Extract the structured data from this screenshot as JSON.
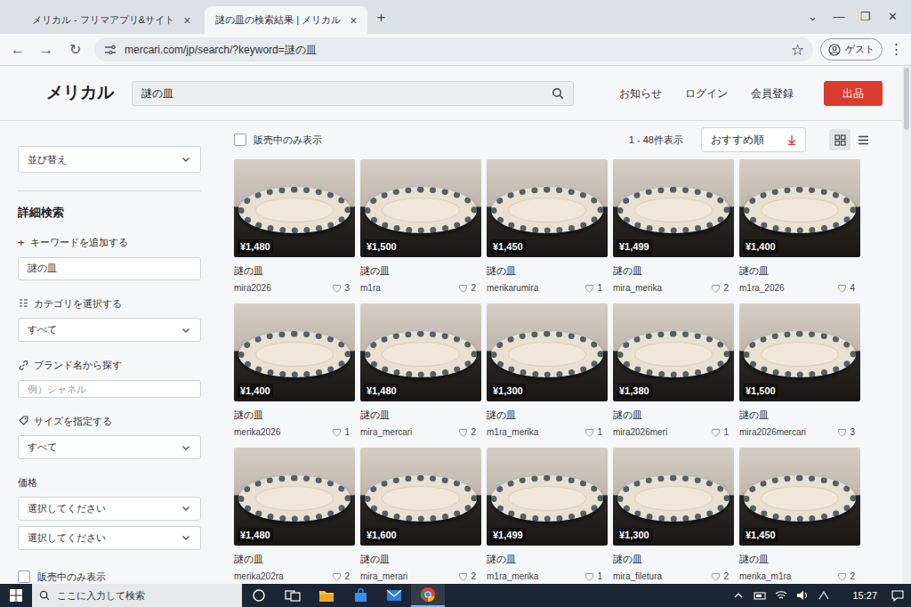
{
  "browser": {
    "tabs": [
      {
        "label": "メリカル - フリマアプリ&サイト",
        "close": "×",
        "selected": false
      },
      {
        "label": "謎の皿の検索結果 | メリカル",
        "close": "×",
        "selected": true
      }
    ],
    "new_tab": "+",
    "window_controls": [
      "⌄",
      "—",
      "❐",
      "✕"
    ],
    "nav": [
      "←",
      "→",
      "↻"
    ],
    "url": "mercari.com/jp/search/?keyword=謎の皿",
    "bookmark": "☆",
    "profile": "ゲスト",
    "menu": "⋮"
  },
  "header": {
    "logo": "メリカル",
    "search_value": "謎の皿",
    "links": [
      "お知らせ",
      "ログイン",
      "会員登録"
    ],
    "sell_button": "出品"
  },
  "sidebar": {
    "sort_label": "並び替え",
    "heading": "詳細検索",
    "keyword": {
      "icon": "+",
      "label": "キーワードを追加する",
      "value": "謎の皿"
    },
    "category": {
      "label": "カテゴリを選択する",
      "value": "すべて"
    },
    "brand": {
      "label": "ブランド名から探す",
      "placeholder": "例）シャネル"
    },
    "size": {
      "label": "サイズを指定する",
      "value": "すべて"
    },
    "price": {
      "label": "価格",
      "min": "選択してください",
      "max": "選択してください"
    },
    "on_sale": {
      "label": "販売中のみ表示",
      "checked": false
    }
  },
  "toolbar": {
    "on_sale": {
      "label": "販売中のみ表示",
      "checked": false
    },
    "count": "1 - 48件表示",
    "sort": "おすすめ順",
    "views": [
      {
        "kind": "grid",
        "selected": true
      },
      {
        "kind": "list",
        "selected": false
      }
    ]
  },
  "grid": {
    "like_icon": "♡",
    "items": [
      {
        "price": "¥1,480",
        "title": "謎の皿",
        "seller": "mira2026",
        "likes": "3"
      },
      {
        "price": "¥1,500",
        "title": "謎の皿",
        "seller": "m1ra",
        "likes": "2"
      },
      {
        "price": "¥1,450",
        "title": "謎の皿",
        "seller": "merikarumira",
        "likes": "1"
      },
      {
        "price": "¥1,499",
        "title": "謎の皿",
        "seller": "mira_merika",
        "likes": "2"
      },
      {
        "price": "¥1,400",
        "title": "謎の皿",
        "seller": "m1ra_2026",
        "likes": "4"
      },
      {
        "price": "¥1,400",
        "title": "謎の皿",
        "seller": "merika2026",
        "likes": "1"
      },
      {
        "price": "¥1,480",
        "title": "謎の皿",
        "seller": "mira_mercari",
        "likes": "2"
      },
      {
        "price": "¥1,300",
        "title": "謎の皿",
        "seller": "m1ra_merika",
        "likes": "1"
      },
      {
        "price": "¥1,380",
        "title": "謎の皿",
        "seller": "mira2026meri",
        "likes": "1"
      },
      {
        "price": "¥1,500",
        "title": "謎の皿",
        "seller": "mira2026mercari",
        "likes": "3"
      },
      {
        "price": "¥1,480",
        "title": "謎の皿",
        "seller": "merika202ra",
        "likes": "2"
      },
      {
        "price": "¥1,600",
        "title": "謎の皿",
        "seller": "mira_merari",
        "likes": "2"
      },
      {
        "price": "¥1,499",
        "title": "謎の皿",
        "seller": "m1ra_merika",
        "likes": "1"
      },
      {
        "price": "¥1,300",
        "title": "謎の皿",
        "seller": "mira_filetura",
        "likes": "2"
      },
      {
        "price": "¥1,450",
        "title": "謎の皿",
        "seller": "merika_m1ra",
        "likes": "2"
      }
    ]
  },
  "taskbar": {
    "search_placeholder": "ここに入力して検索",
    "time": "15:27"
  }
}
